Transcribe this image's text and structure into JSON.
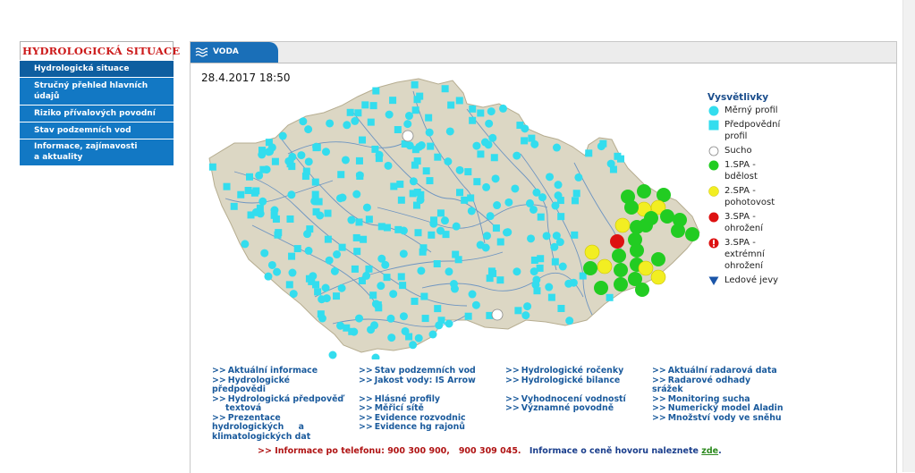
{
  "nav": {
    "title": "HYDROLOGICKÁ SITUACE",
    "items": [
      {
        "label": "Hydrologická situace"
      },
      {
        "label": "Stručný přehled hlavních údajů"
      },
      {
        "label": "Riziko přívalových povodní"
      },
      {
        "label": "Stav podzemních vod"
      },
      {
        "label_line1": "Informace, zajímavosti",
        "label_line2": "a aktuality"
      }
    ]
  },
  "tab": {
    "label": "VODA",
    "icon": "waves-icon"
  },
  "timestamp": "28.4.2017 18:50",
  "legend": {
    "title": "Vysvětlivky",
    "items": [
      {
        "label": "Měrný profil",
        "icon": "circle-cyan",
        "color": "#33ddee"
      },
      {
        "label1": "Předpovědní",
        "label2": "profil",
        "icon": "square-cyan",
        "color": "#33ddee"
      },
      {
        "label": "Sucho",
        "icon": "circle-white",
        "color": "#ffffff"
      },
      {
        "label1": "1.SPA -",
        "label2": "bdělost",
        "icon": "circle-green",
        "color": "#22cc22"
      },
      {
        "label1": "2.SPA -",
        "label2": "pohotovost",
        "icon": "circle-yellow",
        "color": "#f2ee22"
      },
      {
        "label1": "3.SPA -",
        "label2": "ohrožení",
        "icon": "circle-red",
        "color": "#dd1111"
      },
      {
        "label1": "3.SPA -",
        "label2": "extrémní",
        "label3": "ohrožení",
        "icon": "exclamation-red",
        "color": "#dd1111"
      },
      {
        "label": "Ledové jevy",
        "icon": "triangle-blue",
        "color": "#1a55a8"
      }
    ]
  },
  "links": {
    "col1": [
      {
        "l1": "Aktuální informace"
      },
      {
        "l1": "Hydrologické",
        "l2": "předpovědi"
      },
      {
        "l1": "Hydrologická předpověď",
        "l2": "textová"
      },
      {
        "l1": "Prezentace",
        "l2": "hydrologických     a",
        "l3": "klimatologických dat"
      }
    ],
    "col2": [
      {
        "l1": "Stav podzemních vod"
      },
      {
        "l1": "Jakost vody: IS Arrow"
      },
      {
        "l1": "Hlásné profily"
      },
      {
        "l1": "Měřicí sítě"
      },
      {
        "l1": "Evidence rozvodnic"
      },
      {
        "l1": "Evidence hg rajonů"
      }
    ],
    "col3": [
      {
        "l1": "Hydrologické ročenky"
      },
      {
        "l1": "Hydrologické bilance"
      },
      {
        "l1": "Vyhodnocení vodností"
      },
      {
        "l1": "Významné povodně"
      }
    ],
    "col4": [
      {
        "l1": "Aktuální radarová data"
      },
      {
        "l1": "Radarové odhady",
        "l2": "srážek"
      },
      {
        "l1": "Monitoring sucha"
      },
      {
        "l1": "Numerický model Aladin"
      },
      {
        "l1": "Množství vody ve sněhu"
      }
    ],
    "arrow": ">>"
  },
  "footer": {
    "prefix": ">> Informace po telefonu:",
    "numbers": "900 300 900,   900 309 045.",
    "info": "Informace o ceně hovoru naleznete",
    "link": "zde",
    "end": "."
  },
  "colors": {
    "measure": "#33ddee",
    "spa1": "#22cc22",
    "spa2": "#f2ee22",
    "spa3": "#dd1111",
    "nav_bg": "#1278c4",
    "title_red": "#cc1a1a"
  }
}
